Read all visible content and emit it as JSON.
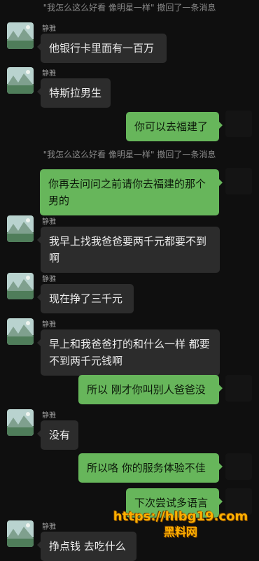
{
  "contact": {
    "name": "静雅"
  },
  "notices": [
    "\"我怎么这么好看 像明星一样\" 撤回了一条消息",
    "\"我怎么这么好看 像明星一样\" 撤回了一条消息"
  ],
  "messages": [
    {
      "side": "in",
      "text": "他银行卡里面有一百万"
    },
    {
      "side": "in",
      "text": "特斯拉男生"
    },
    {
      "side": "out",
      "text": "你可以去福建了"
    },
    {
      "side": "out",
      "text": "你再去问问之前请你去福建的那个男的"
    },
    {
      "side": "in",
      "text": "我早上找我爸爸要两千元都要不到啊"
    },
    {
      "side": "in",
      "text": "现在挣了三千元"
    },
    {
      "side": "in",
      "text": "早上和我爸爸打的和什么一样 都要不到两千元钱啊"
    },
    {
      "side": "out",
      "text": "所以 刚才你叫别人爸爸没"
    },
    {
      "side": "in",
      "text": "没有"
    },
    {
      "side": "out",
      "text": "所以咯 你的服务体验不佳"
    },
    {
      "side": "out",
      "text": "下次尝试多语言"
    },
    {
      "side": "in",
      "text": "挣点钱 去吃什么"
    }
  ],
  "watermark": {
    "url": "https://hlbg19.com",
    "brand": "黑料网"
  },
  "colors": {
    "background": "#0f0f0f",
    "incoming_bubble": "#2c2c2c",
    "outgoing_bubble": "#67b65b",
    "watermark": "#ffb000",
    "logo_red": "#d91f1f"
  },
  "icons": {
    "contact_avatar": "landscape-avatar-icon",
    "self_avatar": "red-letter-l-icon"
  }
}
